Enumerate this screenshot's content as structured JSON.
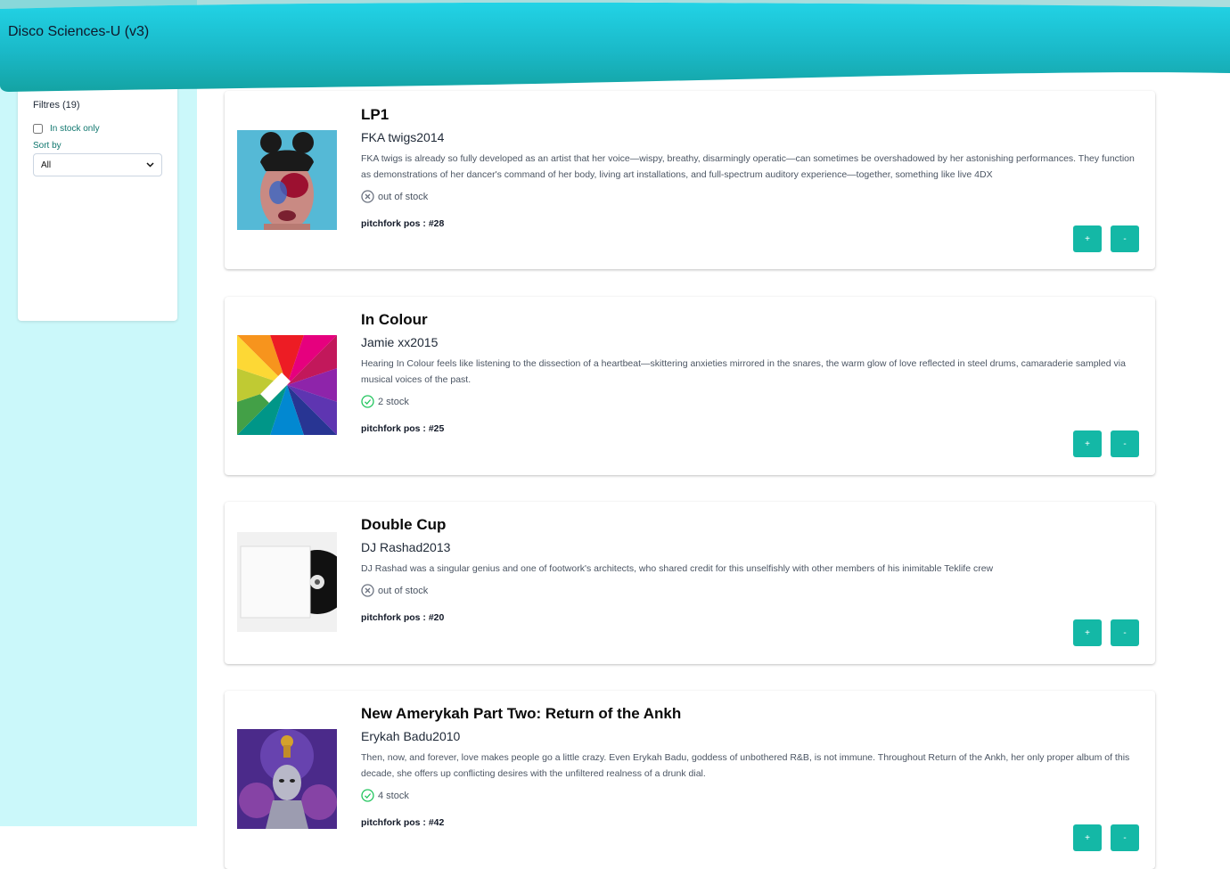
{
  "app": {
    "title": "Disco Sciences-U (v3)"
  },
  "sidebar": {
    "filters_title": "Filtres (19)",
    "in_stock_label": "In stock only",
    "in_stock_checked": false,
    "sort_label": "Sort by",
    "sort_value": "All"
  },
  "colors": {
    "header": "#22c7dc",
    "accent": "#14b8a6",
    "sidebar_bg": "#cbf8fa",
    "in_stock": "#22c55e",
    "out_of_stock": "#6b7280"
  },
  "albums": [
    {
      "title": "LP1",
      "artist": "FKA twigs",
      "year": "2014",
      "description": "FKA twigs is already so fully developed as an artist that her voice—wispy, breathy, disarmingly operatic—can sometimes be overshadowed by her astonishing performances. They function as demonstrations of her dancer's command of her body, living art installations, and full-spectrum auditory experience—together, something like live 4DX",
      "stock_text": "out of stock",
      "stock_icon": "x-circle-icon",
      "pitchfork": "pitchfork pos : #28",
      "plus_label": "+",
      "minus_label": "-"
    },
    {
      "title": "In Colour",
      "artist": "Jamie xx",
      "year": "2015",
      "description": "Hearing In Colour feels like listening to the dissection of a heartbeat—skittering anxieties mirrored in the snares, the warm glow of love reflected in steel drums, camaraderie sampled via musical voices of the past.",
      "stock_text": "2 stock",
      "stock_icon": "check-circle-icon",
      "pitchfork": "pitchfork pos : #25",
      "plus_label": "+",
      "minus_label": "-"
    },
    {
      "title": "Double Cup",
      "artist": "DJ Rashad",
      "year": "2013",
      "description": "DJ Rashad was a singular genius and one of footwork's architects, who shared credit for this unselfishly with other members of his inimitable Teklife crew",
      "stock_text": "out of stock",
      "stock_icon": "x-circle-icon",
      "pitchfork": "pitchfork pos : #20",
      "plus_label": "+",
      "minus_label": "-"
    },
    {
      "title": "New Amerykah Part Two: Return of the Ankh",
      "artist": "Erykah Badu",
      "year": "2010",
      "description": "Then, now, and forever, love makes people go a little crazy. Even Erykah Badu, goddess of unbothered R&B, is not immune. Throughout Return of the Ankh, her only proper album of this decade, she offers up conflicting desires with the unfiltered realness of a drunk dial.",
      "stock_text": "4 stock",
      "stock_icon": "check-circle-icon",
      "pitchfork": "pitchfork pos : #42",
      "plus_label": "+",
      "minus_label": "-"
    }
  ]
}
